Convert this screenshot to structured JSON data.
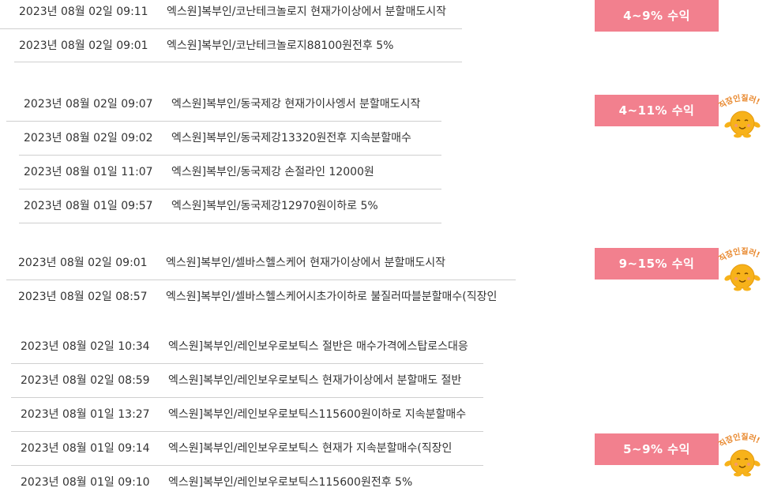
{
  "colors": {
    "badge_bg": "#f2808e",
    "badge_text": "#ffffff",
    "row_text": "#333333",
    "separator": "#cfcfcf",
    "mascot_face": "#f7b21a",
    "mascot_text": "#e8862a"
  },
  "mascot_label": "직장인질러!",
  "groups": [
    {
      "badge": "4~9% 수익",
      "has_mascot": false,
      "rows": [
        {
          "date": "2023년 08월 02일 09:11",
          "title": "엑스원]복부인/코난테크놀로지 현재가이상에서 분할매도시작"
        },
        {
          "date": "2023년 08월 02일 09:01",
          "title": "엑스원]복부인/코난테크놀로지88100원전후 5%"
        }
      ]
    },
    {
      "badge": "4~11% 수익",
      "has_mascot": true,
      "rows": [
        {
          "date": "2023년 08월 02일 09:07",
          "title": "엑스원]복부인/동국제강 현재가이사엥서 분할매도시작"
        },
        {
          "date": "2023년 08월 02일 09:02",
          "title": "엑스원]복부인/동국제강13320원전후 지속분할매수"
        },
        {
          "date": "2023년 08월 01일 11:07",
          "title": "엑스원]복부인/동국제강 손절라인 12000원"
        },
        {
          "date": "2023년 08월 01일 09:57",
          "title": "엑스원]복부인/동국제강12970원이하로 5%"
        }
      ]
    },
    {
      "badge": "9~15% 수익",
      "has_mascot": true,
      "rows": [
        {
          "date": "2023년 08월 02일 09:01",
          "title": "엑스원]복부인/셀바스헬스케어 현재가이상에서 분할매도시작"
        },
        {
          "date": "2023년 08월 02일 08:57",
          "title": "엑스원]복부인/셀바스헬스케어시초가이하로 불질러따블분할매수(직장인"
        }
      ]
    },
    {
      "badge": "5~9% 수익",
      "has_mascot": true,
      "rows": [
        {
          "date": "2023년 08월 02일 10:34",
          "title": "엑스원]복부인/레인보우로보틱스 절반은 매수가격에스탑로스대응"
        },
        {
          "date": "2023년 08월 02일 08:59",
          "title": "엑스원]복부인/레인보우로보틱스 현재가이상에서 분할매도 절반"
        },
        {
          "date": "2023년 08월 01일 13:27",
          "title": "엑스원]복부인/레인보우로보틱스115600원이하로 지속분할매수"
        },
        {
          "date": "2023년 08월 01일 09:14",
          "title": "엑스원]복부인/레인보우로보틱스 현재가 지속분할매수(직장인"
        },
        {
          "date": "2023년 08월 01일 09:10",
          "title": "엑스원]복부인/레인보우로보틱스115600원전후 5%"
        }
      ]
    }
  ]
}
